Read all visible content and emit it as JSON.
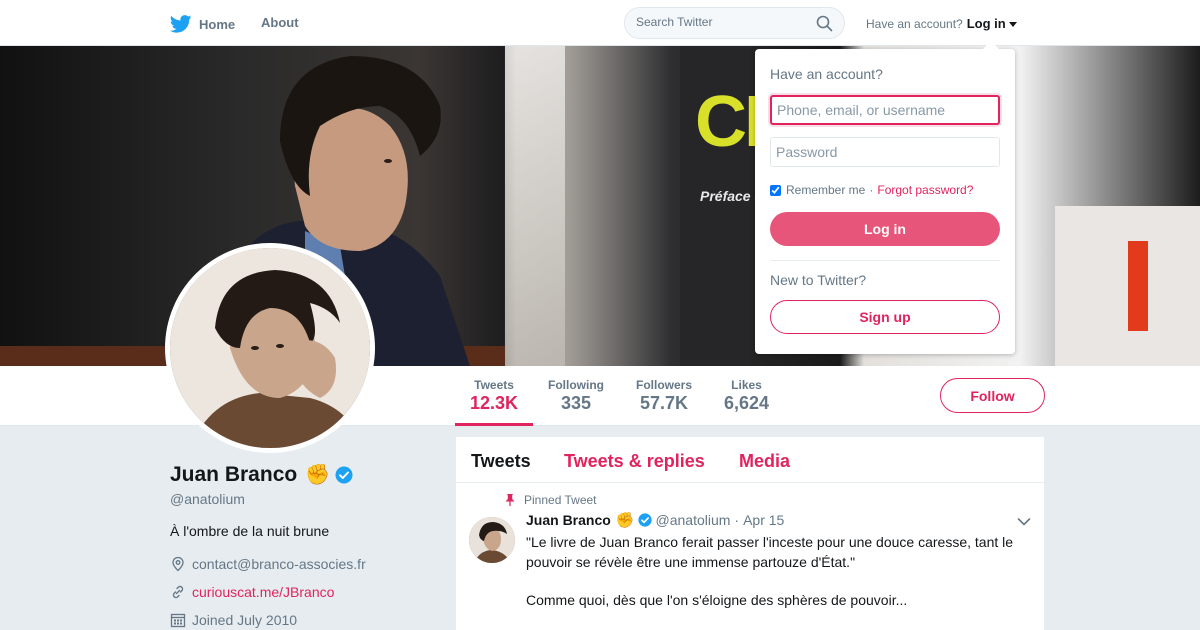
{
  "nav": {
    "home_label": "Home",
    "about_label": "About",
    "search_placeholder": "Search Twitter",
    "have_account_text": "Have an account?",
    "login_label": "Log in"
  },
  "banner": {
    "big_text": "CR",
    "small_text": "Préface d"
  },
  "profile": {
    "name": "Juan Branco",
    "name_emoji": "✊",
    "handle": "@anatolium",
    "bio": "À l'ombre de la nuit brune",
    "email": "contact@branco-associes.fr",
    "website": "curiouscat.me/JBranco",
    "joined": "Joined July 2010"
  },
  "stats": [
    {
      "label": "Tweets",
      "value": "12.3K"
    },
    {
      "label": "Following",
      "value": "335"
    },
    {
      "label": "Followers",
      "value": "57.7K"
    },
    {
      "label": "Likes",
      "value": "6,624"
    }
  ],
  "follow_label": "Follow",
  "timeline": {
    "tabs": [
      "Tweets",
      "Tweets & replies",
      "Media"
    ],
    "pinned_label": "Pinned Tweet",
    "tweet": {
      "author": "Juan Branco",
      "author_emoji": "✊",
      "handle": "@anatolium",
      "dot": "·",
      "date": "Apr 15",
      "text": "\"Le livre de Juan Branco ferait passer l'inceste pour une douce caresse, tant le pouvoir se révèle être une immense partouze d'État.\"",
      "text2": "Comme quoi, dès que l'on s'éloigne des sphères de pouvoir..."
    }
  },
  "login_dropdown": {
    "title": "Have an account?",
    "username_placeholder": "Phone, email, or username",
    "password_placeholder": "Password",
    "remember_label": "Remember me",
    "separator": "·",
    "forgot_label": "Forgot password?",
    "login_button": "Log in",
    "new_text": "New to Twitter?",
    "signup_button": "Sign up"
  },
  "colors": {
    "accent": "#e0245e",
    "twitter_blue": "#1da1f2",
    "verified": "#1da1f2"
  }
}
